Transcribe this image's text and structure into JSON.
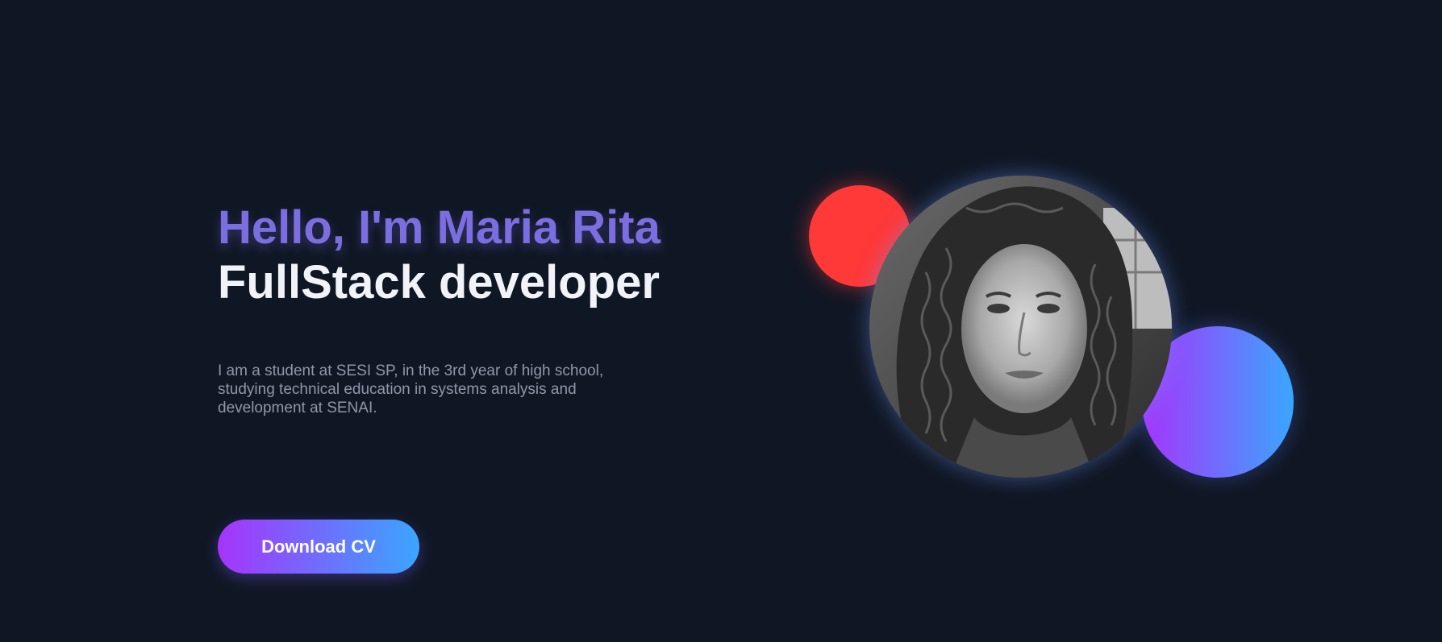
{
  "hero": {
    "greeting": "Hello, I'm Maria Rita",
    "role": "FullStack developer",
    "intro": "I am a student at SESI SP, in the 3rd year of high school, studying technical education in systems analysis and development at SENAI.",
    "button_label": "Download CV"
  },
  "profile": {
    "image_description": "profile photo"
  },
  "colors": {
    "background": "#101724",
    "accent_purple": "#7b6ee0",
    "gradient_start": "#a634fb",
    "gradient_end": "#3aa6ff",
    "decor_red": "#ff3838"
  }
}
